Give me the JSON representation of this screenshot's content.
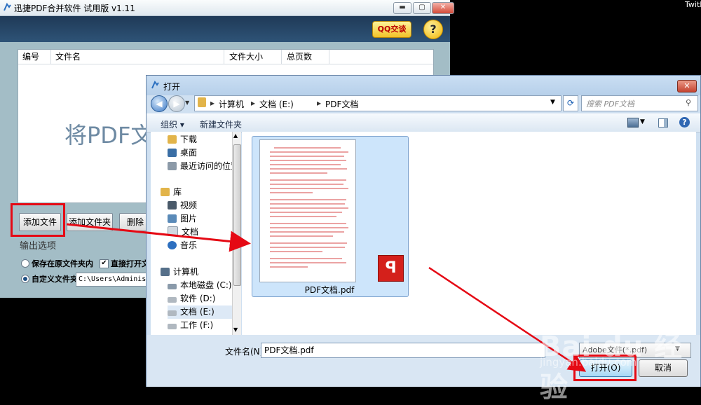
{
  "app": {
    "title": "迅捷PDF合并软件 试用版 v1.11",
    "qq_label": "QQ交谈",
    "help_label": "?",
    "columns": [
      "编号",
      "文件名",
      "文件大小",
      "总页数"
    ],
    "drop_hint": "将PDF文",
    "buttons": {
      "add_file": "添加文件",
      "add_folder": "添加文件夹",
      "delete": "删除"
    },
    "output_options": {
      "title": "输出选项",
      "keep_original": "保存在原文件夹内",
      "open_directly": "直接打开文",
      "custom_folder": "自定义文件夹",
      "custom_path": "C:\\Users\\Administra"
    }
  },
  "corner_text": "TwitB",
  "dialog": {
    "title": "打开",
    "breadcrumb": [
      "计算机",
      "文档 (E:)",
      "PDF文档"
    ],
    "search_placeholder": "搜索 PDF文档",
    "toolbar": {
      "organize": "组织 ▾",
      "new_folder": "新建文件夹"
    },
    "nav_items": [
      {
        "label": "下载",
        "icon": "downloads-folder-icon",
        "color": "#e2b44a"
      },
      {
        "label": "桌面",
        "icon": "desktop-icon",
        "color": "#3a6ea5"
      },
      {
        "label": "最近访问的位置",
        "icon": "recent-places-icon",
        "color": "#8c9aa8"
      },
      {
        "label": "库",
        "icon": "libraries-icon",
        "color": "#e2b44a"
      },
      {
        "label": "视频",
        "icon": "videos-icon",
        "color": "#4a5a6a"
      },
      {
        "label": "图片",
        "icon": "pictures-icon",
        "color": "#5a8ab8"
      },
      {
        "label": "文档",
        "icon": "documents-icon",
        "color": "#d0d8e0"
      },
      {
        "label": "音乐",
        "icon": "music-icon",
        "color": "#2d6fbf"
      },
      {
        "label": "计算机",
        "icon": "computer-icon",
        "color": "#56708a"
      },
      {
        "label": "本地磁盘 (C:)",
        "icon": "drive-c-icon",
        "color": "#8a9aaa"
      },
      {
        "label": "软件 (D:)",
        "icon": "drive-d-icon",
        "color": "#b0b8c0"
      },
      {
        "label": "文档 (E:)",
        "icon": "drive-e-icon",
        "color": "#b0b8c0"
      },
      {
        "label": "工作 (F:)",
        "icon": "drive-f-icon",
        "color": "#b0b8c0"
      }
    ],
    "file": {
      "name": "PDF文档.pdf"
    },
    "filename_label": "文件名(N):",
    "filename_value": "PDF文档.pdf",
    "filetype": "Adobe文件(*.pdf)",
    "open_label": "打开(O)",
    "cancel_label": "取消"
  },
  "watermark": {
    "main": "Bai du 经验",
    "sub": "jingyan.baidu.com"
  }
}
